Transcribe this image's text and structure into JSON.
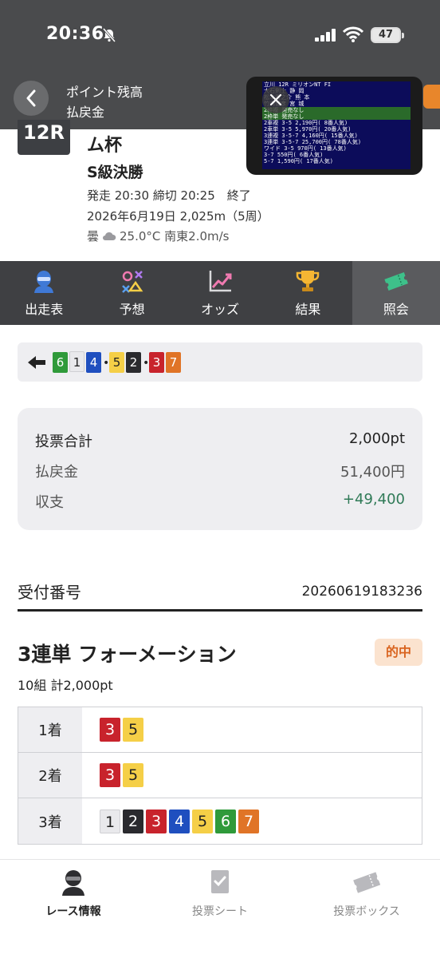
{
  "status_bar": {
    "time": "20:36",
    "battery": "47"
  },
  "header": {
    "title": "ポイント残高",
    "subtitle": "払戻金"
  },
  "race": {
    "number": "12R",
    "name": "ム杯",
    "grade": "S級決勝",
    "times": "発走 20:30 締切 20:25　終了",
    "date_distance": "2026年6月19日 2,025m（5周）",
    "weather": "曇",
    "weather_detail": "25.0°C 南東2.0m/s"
  },
  "video": {
    "rows": [
      "立川 12R        ミリオンNT FI",
      "   大石剣士          静 岡",
      "   松本秀之介        熊 本",
      "   竹内智彦          宮 城",
      "2枠複  発売なし",
      "2枠単  発売なし",
      "2車複 3-5     2,190円( 8番人気)",
      "2車単 3-5     5,970円( 20番人気)",
      "3連複 3-5-7   4,160円( 15番人気)",
      "3連単 3-5-7  25,700円( 78番人気)",
      "ワイド 3-5      970円( 13番人気)",
      "       3-7      550円( 6番人気)",
      "       5-7    1,590円( 17番人気)"
    ]
  },
  "tabs": [
    {
      "label": "出走表",
      "icon": "racer-icon"
    },
    {
      "label": "予想",
      "icon": "prediction-icon"
    },
    {
      "label": "オッズ",
      "icon": "odds-chart-icon"
    },
    {
      "label": "結果",
      "icon": "trophy-icon"
    },
    {
      "label": "照会",
      "icon": "ticket-icon",
      "active": true
    }
  ],
  "result_strip": {
    "groups": [
      [
        "6",
        "1",
        "4"
      ],
      [
        "5",
        "2"
      ],
      [
        "3",
        "7"
      ]
    ]
  },
  "summary": {
    "total_label": "投票合計",
    "total_value": "2,000pt",
    "payout_label": "払戻金",
    "payout_value": "51,400円",
    "balance_label": "収支",
    "balance_value": "+49,400"
  },
  "receipt": {
    "label": "受付番号",
    "value": "20260619183236"
  },
  "bet": {
    "type": "3連単 フォーメーション",
    "badge": "的中",
    "count": "10組 計2,000pt",
    "rows": [
      {
        "label": "1着",
        "numbers": [
          "3",
          "5"
        ]
      },
      {
        "label": "2着",
        "numbers": [
          "3",
          "5"
        ]
      },
      {
        "label": "3着",
        "numbers": [
          "1",
          "2",
          "3",
          "4",
          "5",
          "6",
          "7"
        ]
      }
    ]
  },
  "bottom_nav": [
    {
      "label": "レース情報",
      "icon": "race-info-icon",
      "active": true
    },
    {
      "label": "投票シート",
      "icon": "bet-sheet-icon"
    },
    {
      "label": "投票ボックス",
      "icon": "bet-box-icon"
    }
  ],
  "colors": {
    "accent_green": "#2f7a57",
    "hit_orange": "#d9641f",
    "header_bg": "#4a4b4d"
  }
}
